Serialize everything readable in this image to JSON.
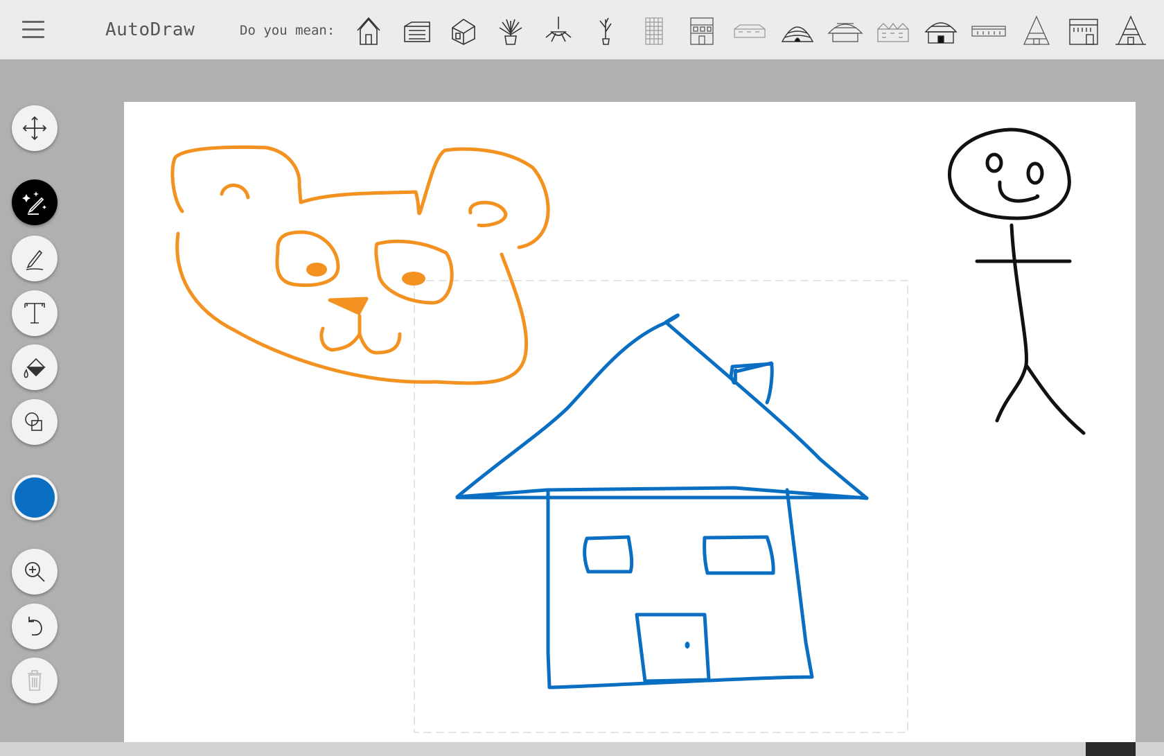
{
  "app": {
    "title": "AutoDraw"
  },
  "suggestions": {
    "label": "Do you mean:",
    "items": [
      {
        "icon": "hut-house-icon"
      },
      {
        "icon": "mailbox-icon"
      },
      {
        "icon": "cube-house-icon"
      },
      {
        "icon": "potted-plant-icon"
      },
      {
        "icon": "hanging-plant-icon"
      },
      {
        "icon": "tall-plant-icon"
      },
      {
        "icon": "tall-building-icon"
      },
      {
        "icon": "apartment-building-icon"
      },
      {
        "icon": "long-house-icon"
      },
      {
        "icon": "round-hut-icon"
      },
      {
        "icon": "wide-hut-icon"
      },
      {
        "icon": "row-houses-icon"
      },
      {
        "icon": "cottage-icon"
      },
      {
        "icon": "flat-building-icon"
      },
      {
        "icon": "tent-icon"
      },
      {
        "icon": "storefront-icon"
      },
      {
        "icon": "a-frame-icon"
      }
    ]
  },
  "toolbar": {
    "tools": [
      {
        "name": "select",
        "icon": "move-arrows-icon"
      },
      {
        "name": "autodraw",
        "icon": "autodraw-sparkle-pencil-icon",
        "active": true
      },
      {
        "name": "draw",
        "icon": "pencil-icon"
      },
      {
        "name": "type",
        "icon": "text-t-icon"
      },
      {
        "name": "fill",
        "icon": "paint-bucket-icon"
      },
      {
        "name": "shape",
        "icon": "shapes-icon"
      },
      {
        "name": "zoom",
        "icon": "zoom-in-icon"
      },
      {
        "name": "undo",
        "icon": "undo-icon"
      },
      {
        "name": "delete",
        "icon": "trash-icon",
        "disabled": true
      }
    ],
    "current_color": "#0a6fc2"
  },
  "drawings": [
    {
      "subject": "bear-face",
      "color": "#f39220"
    },
    {
      "subject": "house",
      "color": "#0a6fc2"
    },
    {
      "subject": "stick-figure",
      "color": "#111111"
    }
  ]
}
